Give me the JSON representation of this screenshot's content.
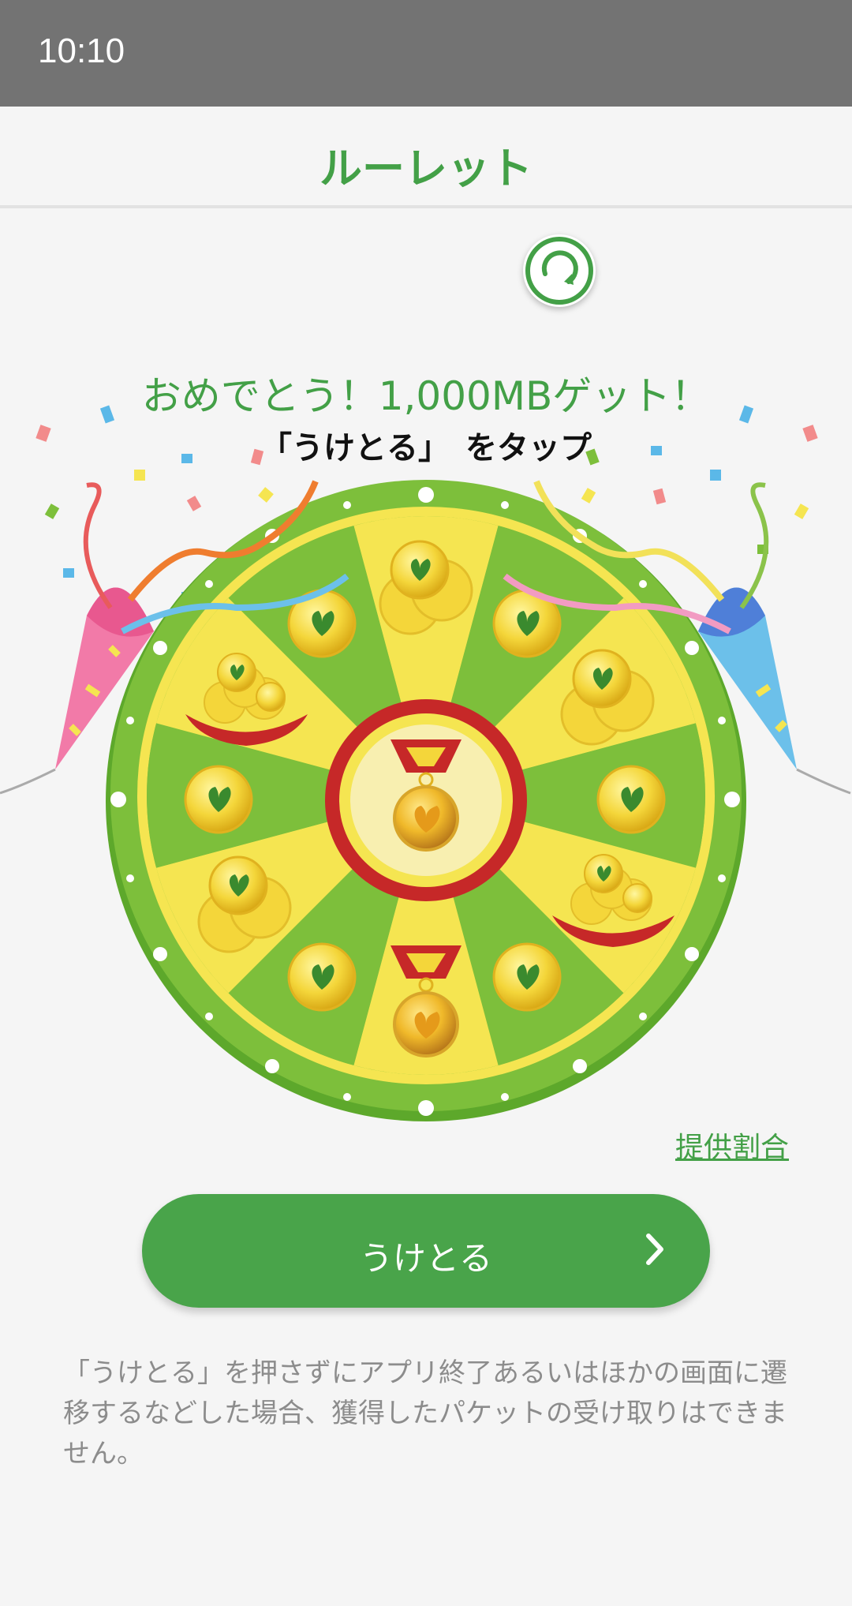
{
  "status_bar": {
    "time": "10:10"
  },
  "header": {
    "title": "ルーレット"
  },
  "reset": {
    "icon": "refresh-icon"
  },
  "result": {
    "message": "おめでとう！1,000MBゲット！",
    "instruction": "「うけとる」　をタップ"
  },
  "wheel": {
    "slots": [
      {
        "prize": "coin-stack",
        "color": "yellow"
      },
      {
        "prize": "coin",
        "color": "green"
      },
      {
        "prize": "coin-stack",
        "color": "yellow"
      },
      {
        "prize": "coin",
        "color": "green"
      },
      {
        "prize": "coin-cushion",
        "color": "yellow"
      },
      {
        "prize": "coin",
        "color": "green"
      },
      {
        "prize": "medal",
        "color": "yellow"
      },
      {
        "prize": "coin",
        "color": "green"
      },
      {
        "prize": "coin-stack",
        "color": "yellow"
      },
      {
        "prize": "coin",
        "color": "green"
      },
      {
        "prize": "coin-cushion",
        "color": "yellow"
      },
      {
        "prize": "coin",
        "color": "green"
      }
    ],
    "center_prize": "medal"
  },
  "links": {
    "rates": "提供割合"
  },
  "actions": {
    "receive": "うけとる"
  },
  "notice": {
    "text": "「うけとる」を押さずにアプリ終了あるいはほかの画面に遷移するなどした場合、獲得したパケットの受け取りはできません。"
  },
  "colors": {
    "accent": "#43a047",
    "button": "#49a44a",
    "wheel_green": "#7dbf3b",
    "wheel_yellow": "#f5e551",
    "hub_red": "#c62828"
  }
}
